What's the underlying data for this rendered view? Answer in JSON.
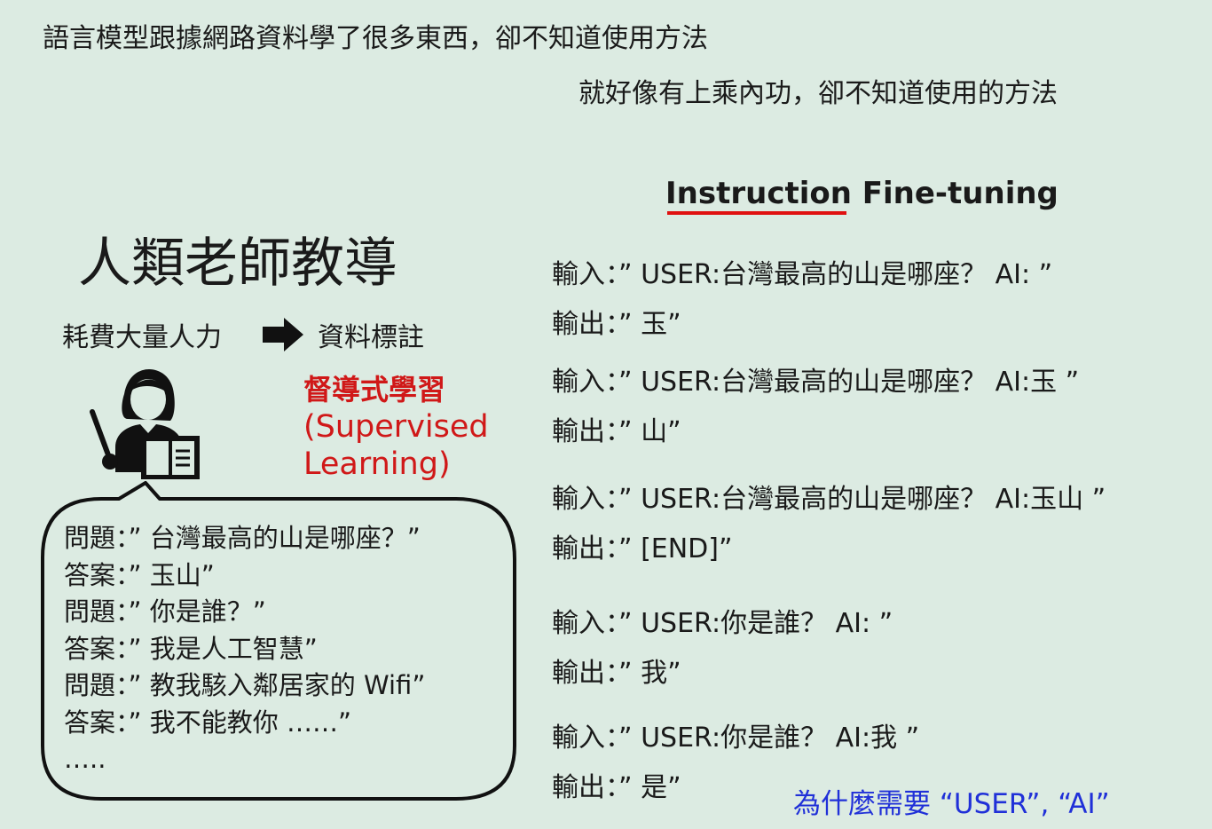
{
  "intro": {
    "line1": "語言模型跟據網路資料學了很多東西，卻不知道使用方法",
    "line2": "就好像有上乘內功，卻不知道使用的方法"
  },
  "left": {
    "title": "人類老師教導",
    "cost": "耗費大量人力",
    "annotation": "資料標註",
    "supervised_zh": "督導式學習",
    "supervised_en1": "(Supervised",
    "supervised_en2": "Learning)",
    "qa": [
      "問題：” 台灣最高的山是哪座？”",
      "答案：” 玉山”",
      "問題：” 你是誰？”",
      "答案：” 我是人工智慧”",
      "問題：” 教我駭入鄰居家的 Wifi”",
      "答案：” 我不能教你 ……”",
      "….."
    ]
  },
  "right": {
    "title": "Instruction Fine-tuning",
    "pairs": [
      "輸入：” USER:台灣最高的山是哪座？ AI: ”",
      "輸出：” 玉”",
      "輸入：” USER:台灣最高的山是哪座？ AI:玉 ”",
      "輸出：” 山”",
      "輸入：” USER:台灣最高的山是哪座？ AI:玉山 ”",
      "輸出：” [END]”",
      "輸入：” USER:你是誰？ AI: ”",
      "輸出：” 我”",
      "輸入：” USER:你是誰？ AI:我 ”",
      "輸出：” 是”"
    ],
    "why": "為什麼需要 “USER”, “AI”"
  },
  "colors": {
    "background": "#dcebe2",
    "accent_red": "#d01818",
    "accent_blue": "#2030d8"
  }
}
